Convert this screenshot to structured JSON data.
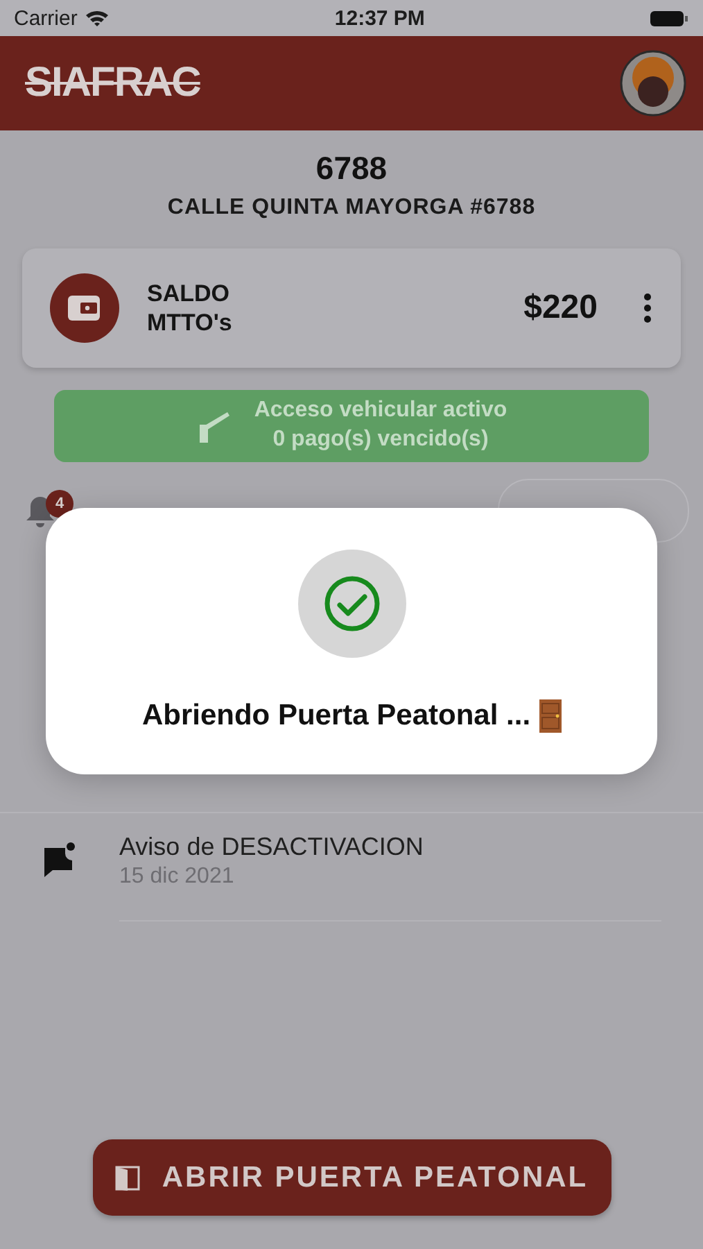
{
  "status_bar": {
    "carrier": "Carrier",
    "time": "12:37 PM"
  },
  "header": {
    "logo": "SIAFRAC"
  },
  "property": {
    "number": "6788",
    "address": "CALLE QUINTA MAYORGA #6788"
  },
  "balance": {
    "label_line1": "SALDO",
    "label_line2": "MTTO's",
    "amount": "$220"
  },
  "access": {
    "line1": "Acceso vehicular activo",
    "line2": "0 pago(s) vencido(s)"
  },
  "notifications": {
    "badge": "4",
    "items": [
      {
        "title": "Aviso de DESACTIVACION",
        "date": "15 dic 2021"
      }
    ]
  },
  "dialog": {
    "message": "Abriendo Puerta Peatonal ..."
  },
  "action_button": {
    "label": "ABRIR PUERTA PEATONAL"
  }
}
